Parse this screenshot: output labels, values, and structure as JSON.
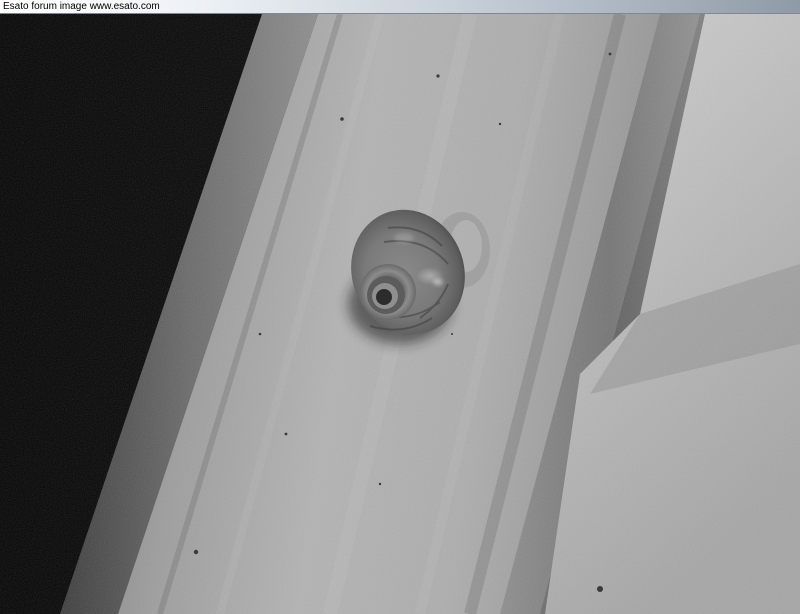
{
  "caption": {
    "text": "Esato forum image www.esato.com"
  },
  "photo": {
    "subject": "snail-on-wall",
    "tone": "grayscale"
  },
  "colors": {
    "background": "#000000",
    "title_bar_start": "#ffffff",
    "title_bar_end": "#8f9aa8",
    "caption_text": "#000000"
  }
}
